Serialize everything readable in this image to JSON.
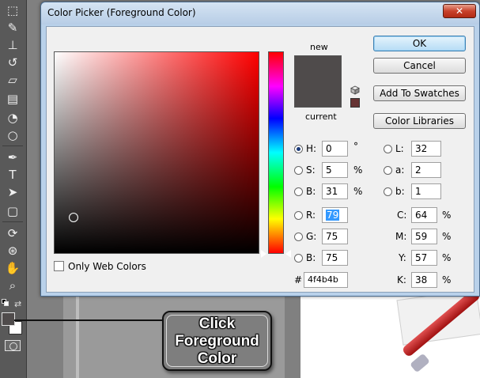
{
  "dialog": {
    "title": "Color Picker (Foreground Color)",
    "close_glyph": "✕",
    "new_label": "new",
    "current_label": "current",
    "new_color": "#4f4b4b",
    "current_color": "#4f4b4b",
    "websafe_color": "#663333",
    "buttons": {
      "ok": "OK",
      "cancel": "Cancel",
      "add_swatches": "Add To Swatches",
      "color_libraries": "Color Libraries"
    },
    "only_web_colors": {
      "label": "Only Web Colors",
      "checked": false
    },
    "hsb": {
      "h": {
        "label": "H:",
        "value": "0",
        "unit": "°",
        "selected": true
      },
      "s": {
        "label": "S:",
        "value": "5",
        "unit": "%",
        "selected": false
      },
      "b": {
        "label": "B:",
        "value": "31",
        "unit": "%",
        "selected": false
      }
    },
    "rgb": {
      "r": {
        "label": "R:",
        "value": "79",
        "selected": false
      },
      "g": {
        "label": "G:",
        "value": "75",
        "selected": false
      },
      "b": {
        "label": "B:",
        "value": "75",
        "selected": false
      }
    },
    "lab": {
      "l": {
        "label": "L:",
        "value": "32"
      },
      "a": {
        "label": "a:",
        "value": "2"
      },
      "b": {
        "label": "b:",
        "value": "1"
      }
    },
    "cmyk": {
      "c": {
        "label": "C:",
        "value": "64",
        "unit": "%"
      },
      "m": {
        "label": "M:",
        "value": "59",
        "unit": "%"
      },
      "y": {
        "label": "Y:",
        "value": "57",
        "unit": "%"
      },
      "k": {
        "label": "K:",
        "value": "38",
        "unit": "%"
      }
    },
    "hex": {
      "label": "#",
      "value": "4f4b4b"
    }
  },
  "toolbar": {
    "tools": [
      "move",
      "lasso",
      "stamp",
      "brush-history",
      "eraser",
      "gradient",
      "blur",
      "dodge",
      "pen",
      "type",
      "path-select",
      "shape",
      "3d-rotate",
      "3d-orbit",
      "hand",
      "zoom"
    ],
    "foreground_color": "#4f4b4b",
    "background_color": "#ffffff"
  },
  "callout": {
    "line1": "Click",
    "line2": "Foreground",
    "line3": "Color"
  }
}
